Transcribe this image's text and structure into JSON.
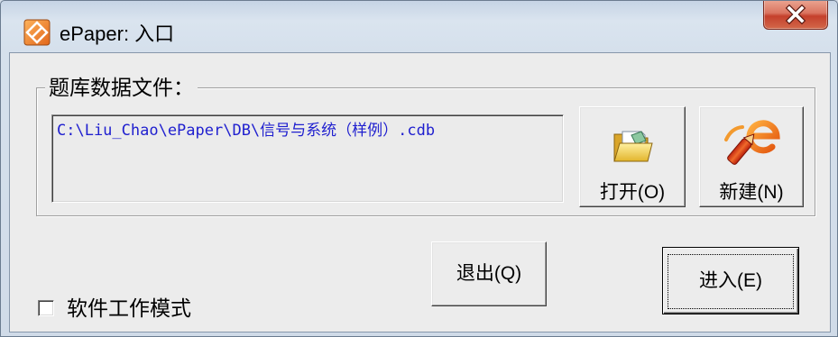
{
  "window": {
    "title": "ePaper: 入口",
    "app_icon": "app-icon",
    "close_icon": "close-icon"
  },
  "group": {
    "label": "题库数据文件："
  },
  "path_field": {
    "value": "C:\\Liu_Chao\\ePaper\\DB\\信号与系统（样例）.cdb"
  },
  "buttons": {
    "open": {
      "label": "打开(O)",
      "icon": "folder-open-icon"
    },
    "new": {
      "label": "新建(N)",
      "icon": "new-document-icon"
    },
    "exit": {
      "label": "退出(Q)"
    },
    "enter": {
      "label": "进入(E)",
      "focused": true
    }
  },
  "checkbox": {
    "label": "软件工作模式",
    "checked": false
  },
  "colors": {
    "path_text": "#1F1FCF",
    "close_button": "#C4402C",
    "dialog_background": "#ECECEC"
  }
}
